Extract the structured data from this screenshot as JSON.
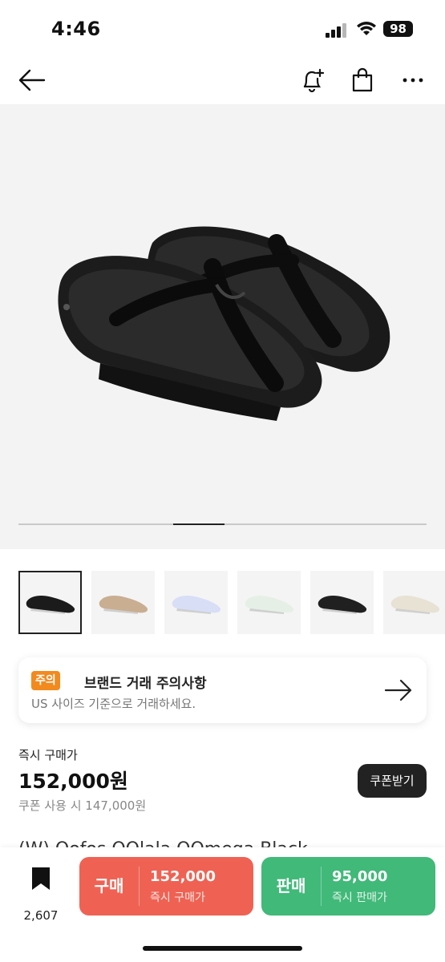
{
  "status_bar": {
    "time": "4:46",
    "battery": "98"
  },
  "nav": {
    "back_icon": "arrow-left-icon",
    "bell_icon": "bell-plus-icon",
    "bag_icon": "shopping-bag-icon",
    "more_icon": "more-horizontal-icon"
  },
  "gallery": {
    "progress_fraction_start": 0.38,
    "progress_fraction_width": 0.125
  },
  "thumbnails": [
    {
      "color": "#1b1b1b",
      "selected": true
    },
    {
      "color": "#c9ae92",
      "selected": false
    },
    {
      "color": "#d9def7",
      "selected": false
    },
    {
      "color": "#e6efe6",
      "selected": false
    },
    {
      "color": "#202020",
      "selected": false
    },
    {
      "color": "#e8e2d4",
      "selected": false
    }
  ],
  "notice": {
    "badge": "주의",
    "title": "브랜드 거래 주의사항",
    "subtitle": "US 사이즈 기준으로 거래하세요."
  },
  "price": {
    "label": "즉시 구매가",
    "value": "152,000원",
    "coupon_text": "쿠폰 사용 시 147,000원",
    "coupon_button": "쿠폰받기"
  },
  "product": {
    "title_peek": "(W) Oofos OOlala OOmega Black"
  },
  "bottom_bar": {
    "bookmark_count": "2,607",
    "buy": {
      "label": "구매",
      "amount": "152,000",
      "sub": "즉시 구매가"
    },
    "sell": {
      "label": "판매",
      "amount": "95,000",
      "sub": "즉시 판매가"
    }
  },
  "colors": {
    "buy": "#ef6253",
    "sell": "#41b979",
    "badge": "#f28a1e"
  }
}
